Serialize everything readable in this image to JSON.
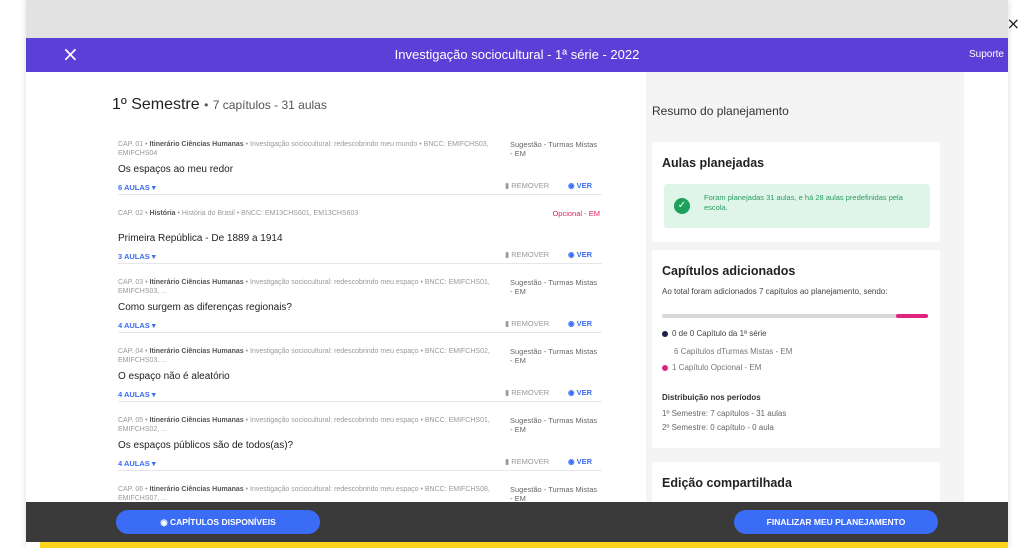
{
  "header": {
    "title": "Investigação sociocultural - 1ª série - 2022",
    "support": "Suporte",
    "close_icon": "×",
    "outer_close": "×"
  },
  "semester": {
    "title": "1º Semestre",
    "separator": "•",
    "summary": "7 capítulos - 31 aulas"
  },
  "chapters": [
    {
      "meta_cap": "CAP. 01 •",
      "meta_path": "Itinerário Ciências Humanas",
      "meta_rest": "• Investigação sociocultural: redescobrindo meu mundo • BNCC: EMIFCHS03, EMIFCHS04",
      "tag": "Sugestão - Turmas Mistas - EM",
      "optional": false,
      "title": "Os espaços ao meu redor",
      "aulas": "6 AULAS ▾",
      "remove": "▮ REMOVER",
      "view": "◉ VER"
    },
    {
      "meta_cap": "CAP. 02 •",
      "meta_path": "História",
      "meta_rest": "• História do Brasil • BNCC: EM13CHS601, EM13CHS603",
      "tag": "Opcional - EM",
      "optional": true,
      "title": "Primeira República - De 1889 a 1914",
      "aulas": "3 AULAS ▾",
      "remove": "▮ REMOVER",
      "view": "◉ VER"
    },
    {
      "meta_cap": "CAP. 03 •",
      "meta_path": "Itinerário Ciências Humanas",
      "meta_rest": "• Investigação sociocultural: redescobrindo meu espaço • BNCC: EMIFCHS01, EMIFCHS03, ...",
      "tag": "Sugestão - Turmas Mistas - EM",
      "optional": false,
      "title": "Como surgem as diferenças regionais?",
      "aulas": "4 AULAS ▾",
      "remove": "▮ REMOVER",
      "view": "◉ VER"
    },
    {
      "meta_cap": "CAP. 04 •",
      "meta_path": "Itinerário Ciências Humanas",
      "meta_rest": "• Investigação sociocultural: redescobrindo meu espaço • BNCC: EMIFCHS02, EMIFCHS03, ...",
      "tag": "Sugestão - Turmas Mistas - EM",
      "optional": false,
      "title": "O espaço não é aleatório",
      "aulas": "4 AULAS ▾",
      "remove": "▮ REMOVER",
      "view": "◉ VER"
    },
    {
      "meta_cap": "CAP. 05 •",
      "meta_path": "Itinerário Ciências Humanas",
      "meta_rest": "• Investigação sociocultural: redescobrindo meu espaço • BNCC: EMIFCHS01, EMIFCHS02, ...",
      "tag": "Sugestão - Turmas Mistas - EM",
      "optional": false,
      "title": "Os espaços públicos são de todos(as)?",
      "aulas": "4 AULAS ▾",
      "remove": "▮ REMOVER",
      "view": "◉ VER"
    },
    {
      "meta_cap": "CAP. 06 •",
      "meta_path": "Itinerário Ciências Humanas",
      "meta_rest": "• Investigação sociocultural: redescobrindo meu espaço • BNCC: EMIFCHS08, EMIFCHS07, ...",
      "tag": "Sugestão - Turmas Mistas - EM",
      "optional": false,
      "title": "",
      "aulas": "",
      "remove": "",
      "view": ""
    }
  ],
  "summary": {
    "title": "Resumo do planejamento",
    "planned": {
      "title": "Aulas planejadas",
      "text": "Foram planejadas 31 aulas, e há 28 aulas predefinidas pela escola."
    },
    "added": {
      "title": "Capítulos adicionados",
      "text": "Ao total foram adicionados 7 capítulos ao planejamento, sendo:",
      "progress": 0.12,
      "line1": "0 de 0 Capítulo da 1ª série",
      "line2": "6 Capítulos dTurmas Mistas - EM",
      "line3": "1 Capítulo Opcional - EM",
      "dist_title": "Distribuição nos períodos",
      "dist1": "1º Semestre: 7 capítulos - 31 aulas",
      "dist2": "2º Semestre: 0 capítulo - 0 aula"
    },
    "shared": {
      "title": "Edição compartilhada"
    }
  },
  "footer": {
    "available": "◉ CAPÍTULOS DISPONÍVEIS",
    "finish": "FINALIZAR MEU PLANEJAMENTO"
  },
  "colors": {
    "header": "#5b3fd6",
    "accent": "#3b6cf5",
    "optional": "#e0245e",
    "success": "#1fa05a"
  }
}
